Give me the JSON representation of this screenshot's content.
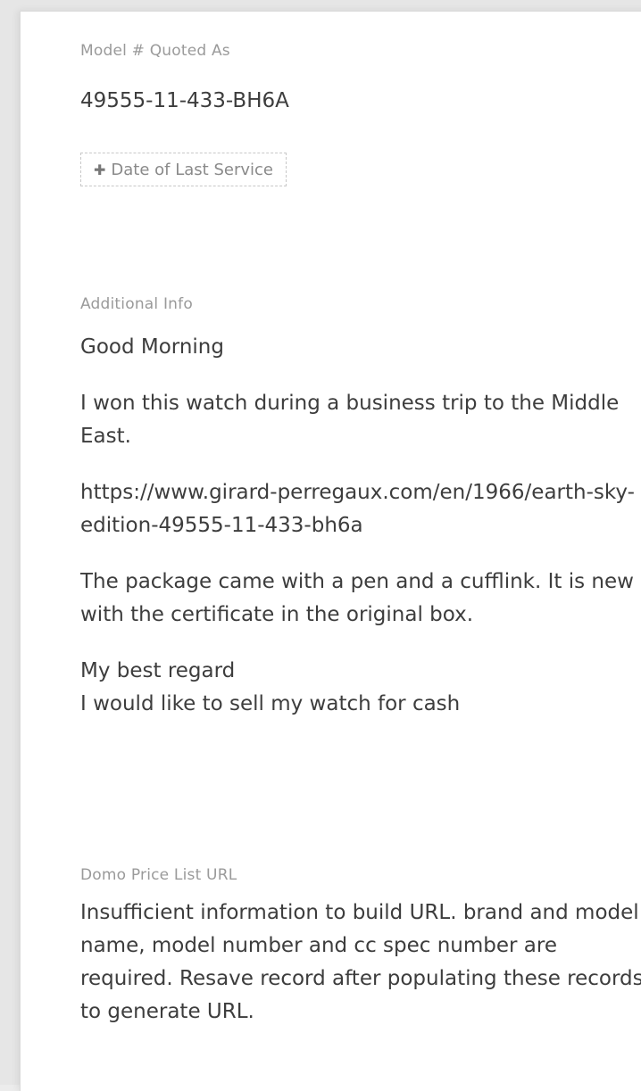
{
  "model_quoted": {
    "label": "Model # Quoted As",
    "value": "49555-11-433-BH6A"
  },
  "add_field": {
    "icon": "plus-icon",
    "label": "Date of Last Service"
  },
  "additional_info": {
    "label": "Additional Info",
    "greeting": "Good Morning",
    "paragraph_1": "I won this watch during a business trip to the Middle East.",
    "url": "https://www.girard-perregaux.com/en/1966/earth-sky-edition-49555-11-433-bh6a",
    "paragraph_2": "The package came with a pen and a cufflink. It is new with the certificate in the original box.",
    "closing_1": "My best regard",
    "closing_2": "I would like to sell my watch for cash"
  },
  "domo_price_list": {
    "label": "Domo Price List URL",
    "value": "Insufficient information to build URL. brand and model name, model number and cc spec number are required. Resave record after populating these records to generate URL."
  }
}
